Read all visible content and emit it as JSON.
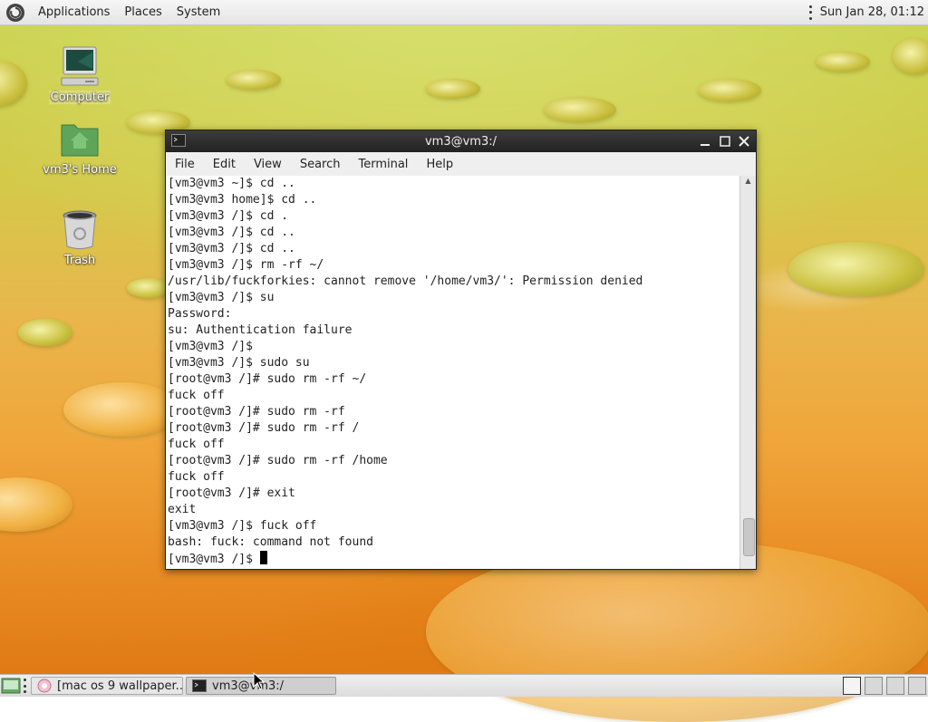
{
  "top_panel": {
    "menus": [
      "Applications",
      "Places",
      "System"
    ],
    "clock": "Sun Jan 28, 01:12"
  },
  "desktop_icons": [
    {
      "label": "Computer",
      "icon": "computer-icon"
    },
    {
      "label": "vm3's Home",
      "icon": "home-folder-icon"
    },
    {
      "label": "Trash",
      "icon": "trash-icon"
    }
  ],
  "terminal": {
    "title": "vm3@vm3:/",
    "menu": [
      "File",
      "Edit",
      "View",
      "Search",
      "Terminal",
      "Help"
    ],
    "lines": [
      "[vm3@vm3 ~]$ cd ..",
      "[vm3@vm3 home]$ cd ..",
      "[vm3@vm3 /]$ cd .",
      "[vm3@vm3 /]$ cd ..",
      "[vm3@vm3 /]$ cd ..",
      "[vm3@vm3 /]$ rm -rf ~/",
      "/usr/lib/fuckforkies: cannot remove '/home/vm3/': Permission denied",
      "[vm3@vm3 /]$ su",
      "Password:",
      "su: Authentication failure",
      "[vm3@vm3 /]$",
      "[vm3@vm3 /]$ sudo su",
      "[root@vm3 /]# sudo rm -rf ~/",
      "fuck off",
      "[root@vm3 /]# sudo rm -rf",
      "[root@vm3 /]# sudo rm -rf /",
      "fuck off",
      "[root@vm3 /]# sudo rm -rf /home",
      "fuck off",
      "[root@vm3 /]# exit",
      "exit",
      "[vm3@vm3 /]$ fuck off",
      "bash: fuck: command not found"
    ],
    "prompt": "[vm3@vm3 /]$ "
  },
  "taskbar": {
    "tasks": [
      {
        "label": "[mac os 9 wallpaper..."
      },
      {
        "label": "vm3@vm3:/"
      }
    ]
  },
  "colors": {
    "panel_bg": "#ececec",
    "titlebar_bg": "#2e2e2e",
    "terminal_bg": "#ffffff"
  }
}
